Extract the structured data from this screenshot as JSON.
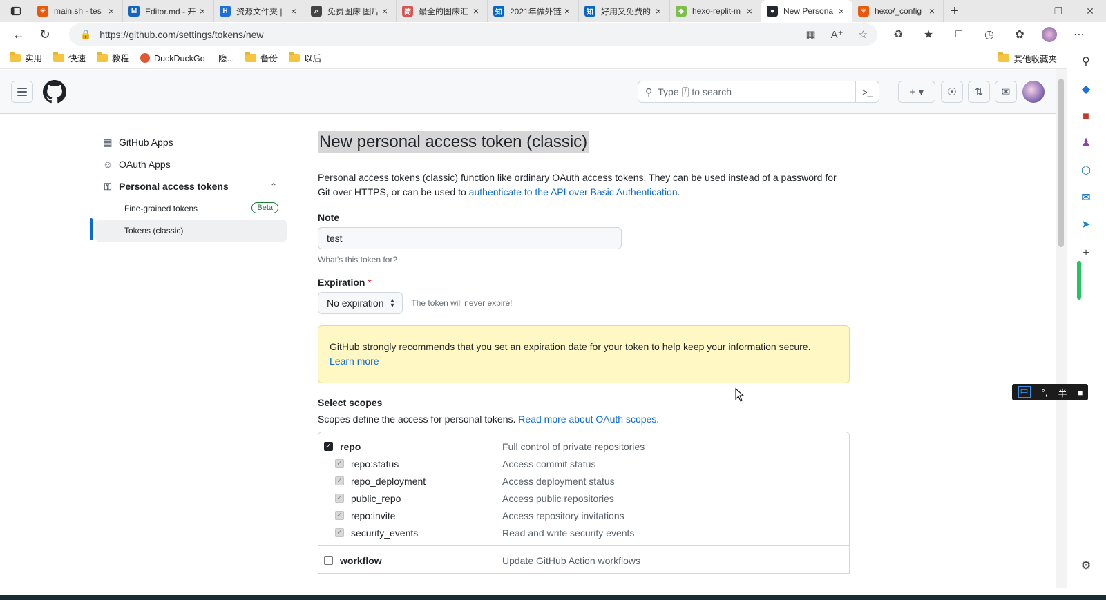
{
  "browser": {
    "tabs": [
      {
        "title": "main.sh - tes",
        "color": "#e8590c",
        "glyph": "✳"
      },
      {
        "title": "Editor.md - 开",
        "color": "#1565c0",
        "glyph": "M"
      },
      {
        "title": "资源文件夹 |",
        "color": "#1e6fd9",
        "glyph": "H"
      },
      {
        "title": "免费图床 图片",
        "color": "#444",
        "glyph": "⌕"
      },
      {
        "title": "最全的图床汇",
        "color": "#d9534f",
        "glyph": "简"
      },
      {
        "title": "2021年做外链",
        "color": "#0a66c2",
        "glyph": "知"
      },
      {
        "title": "好用又免费的",
        "color": "#0a66c2",
        "glyph": "知"
      },
      {
        "title": "hexo-replit-m",
        "color": "#7cbf4a",
        "glyph": "◆"
      },
      {
        "title": "New Persona",
        "color": "#24292f",
        "glyph": "●"
      },
      {
        "title": "hexo/_config",
        "color": "#e8590c",
        "glyph": "✳"
      }
    ],
    "active_tab_index": 8,
    "url": "https://github.com/settings/tokens/new",
    "bookmarks": [
      "实用",
      "快速",
      "教程",
      "DuckDuckGo — 隐...",
      "备份",
      "以后"
    ],
    "bookmarks_other": "其他收藏夹"
  },
  "header": {
    "search_placeholder_pre": "Type",
    "search_slash": "/",
    "search_placeholder_post": "to search"
  },
  "sidebar": {
    "github_apps": "GitHub Apps",
    "oauth_apps": "OAuth Apps",
    "personal_tokens": "Personal access tokens",
    "fine_grained": "Fine-grained tokens",
    "beta": "Beta",
    "classic": "Tokens (classic)"
  },
  "main": {
    "title": "New personal access token (classic)",
    "desc_text": "Personal access tokens (classic) function like ordinary OAuth access tokens. They can be used instead of a password for Git over HTTPS, or can be used to ",
    "desc_link": "authenticate to the API over Basic Authentication",
    "desc_end": ".",
    "note_label": "Note",
    "note_value": "test",
    "note_hint": "What's this token for?",
    "expiration_label": "Expiration",
    "expiration_required": "*",
    "expiration_value": "No expiration",
    "expiration_note": "The token will never expire!",
    "flash_text": "GitHub strongly recommends that you set an expiration date for your token to help keep your information secure.",
    "flash_link": "Learn more",
    "scopes_title": "Select scopes",
    "scopes_desc": "Scopes define the access for personal tokens.",
    "scopes_link": "Read more about OAuth scopes.",
    "scopes": [
      {
        "name": "repo",
        "desc": "Full control of private repositories",
        "checked": true,
        "children": [
          {
            "name": "repo:status",
            "desc": "Access commit status"
          },
          {
            "name": "repo_deployment",
            "desc": "Access deployment status"
          },
          {
            "name": "public_repo",
            "desc": "Access public repositories"
          },
          {
            "name": "repo:invite",
            "desc": "Access repository invitations"
          },
          {
            "name": "security_events",
            "desc": "Read and write security events"
          }
        ]
      },
      {
        "name": "workflow",
        "desc": "Update GitHub Action workflows",
        "checked": false,
        "children": []
      }
    ]
  },
  "ime": {
    "mode": "中",
    "punct": "°,",
    "width": "半"
  }
}
